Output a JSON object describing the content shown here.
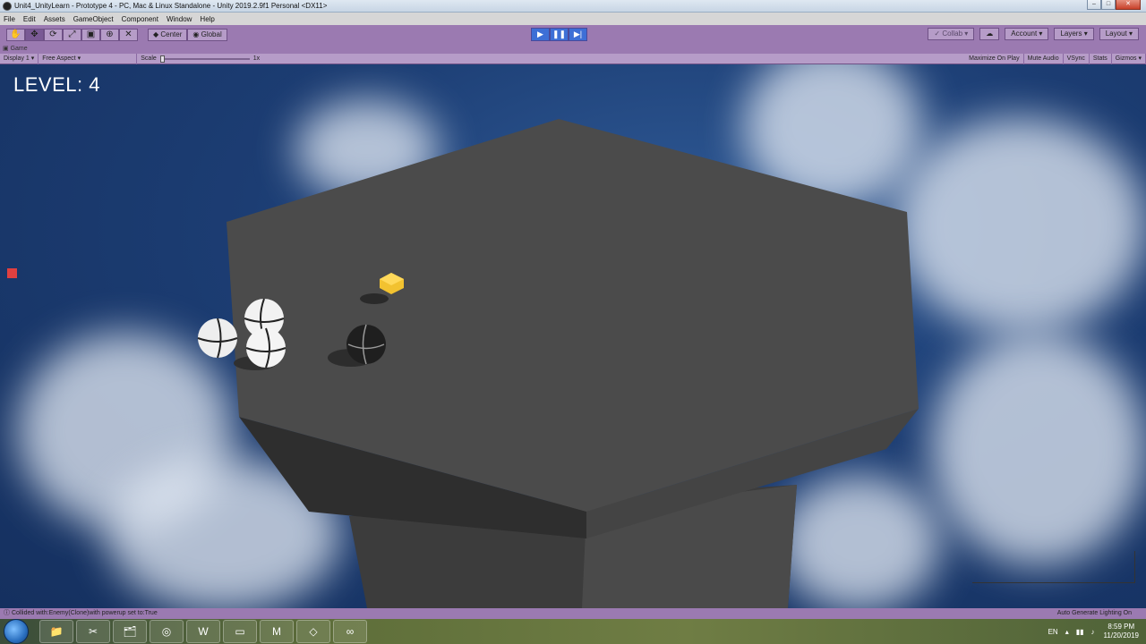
{
  "window": {
    "title": "Unit4_UnityLearn - Prototype 4 - PC, Mac & Linux Standalone - Unity 2019.2.9f1 Personal <DX11>"
  },
  "menu": [
    "File",
    "Edit",
    "Assets",
    "GameObject",
    "Component",
    "Window",
    "Help"
  ],
  "toolbar": {
    "center_label": "Center",
    "global_label": "Global",
    "collab_label": "Collab",
    "account_label": "Account",
    "layers_label": "Layers",
    "layout_label": "Layout"
  },
  "game_tab": {
    "label": "Game"
  },
  "game_bar": {
    "display": "Display 1",
    "aspect": "Free Aspect",
    "scale_label": "Scale",
    "scale_value": "1x",
    "maximize": "Maximize On Play",
    "mute": "Mute Audio",
    "vsync": "VSync",
    "stats": "Stats",
    "gizmos": "Gizmos"
  },
  "game": {
    "level_text": "LEVEL: 4"
  },
  "status": {
    "message": "Collided with:Enemy(Clone)with powerup set to:True",
    "lighting": "Auto Generate Lighting On"
  },
  "taskbar": {
    "language": "EN",
    "time": "8:59 PM",
    "date": "11/20/2019"
  },
  "colors": {
    "editor_tint": "#9b7ab1",
    "play_active": "#3d6fd6",
    "sky": "#1c3d73",
    "platform_top": "#4a4a4a"
  }
}
